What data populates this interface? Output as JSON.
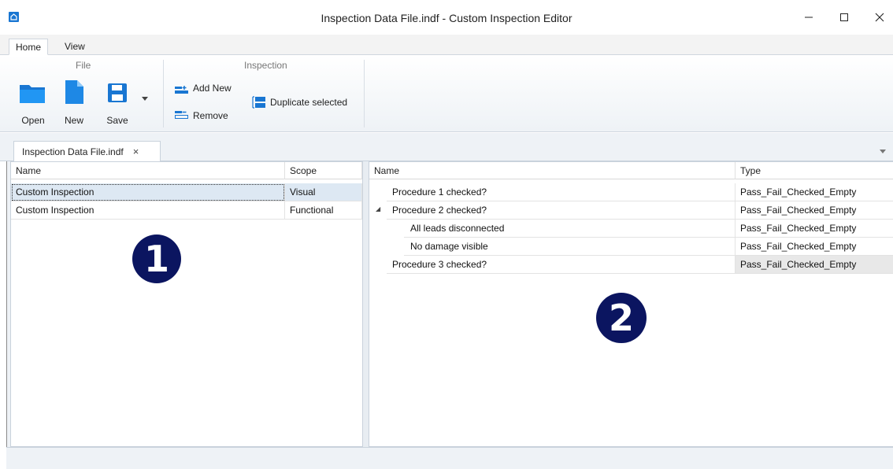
{
  "window": {
    "title": "Inspection Data File.indf - Custom Inspection Editor",
    "icon": "app-icon",
    "controls": [
      "minimize-icon",
      "maximize-icon",
      "close-icon"
    ]
  },
  "ribbon": {
    "tabs": [
      {
        "label": "Home",
        "active": true
      },
      {
        "label": "View",
        "active": false
      }
    ],
    "groups": {
      "file": {
        "title": "File",
        "buttons": [
          {
            "label": "Open",
            "icon": "folder-icon"
          },
          {
            "label": "New",
            "icon": "new-document-icon"
          },
          {
            "label": "Save",
            "icon": "save-icon"
          }
        ]
      },
      "inspection": {
        "title": "Inspection",
        "buttons": [
          {
            "label": "Add New",
            "icon": "add-row-icon"
          },
          {
            "label": "Remove",
            "icon": "remove-row-icon"
          },
          {
            "label": "Duplicate selected",
            "icon": "duplicate-icon"
          }
        ]
      }
    }
  },
  "document_tab": {
    "label": "Inspection Data File.indf",
    "close": "×"
  },
  "left_grid": {
    "columns": [
      "Name",
      "Scope"
    ],
    "rows": [
      {
        "name": "Custom Inspection",
        "scope": "Visual",
        "selected": true
      },
      {
        "name": "Custom Inspection",
        "scope": "Functional",
        "selected": false
      }
    ],
    "badge": "1"
  },
  "right_grid": {
    "columns": [
      "Name",
      "Type"
    ],
    "rows": [
      {
        "name": "Procedure 1 checked?",
        "type": "Pass_Fail_Checked_Empty",
        "level": 0,
        "expander": ""
      },
      {
        "name": "Procedure 2 checked?",
        "type": "Pass_Fail_Checked_Empty",
        "level": 0,
        "expander": "◢"
      },
      {
        "name": "All leads disconnected",
        "type": "Pass_Fail_Checked_Empty",
        "level": 1,
        "expander": ""
      },
      {
        "name": "No damage visible",
        "type": "Pass_Fail_Checked_Empty",
        "level": 1,
        "expander": ""
      },
      {
        "name": "Procedure 3 checked?",
        "type": "Pass_Fail_Checked_Empty",
        "level": 0,
        "expander": ""
      }
    ],
    "badge": "2"
  },
  "colors": {
    "accent": "#1976d2",
    "badge": "#0b1560",
    "selection": "#dde8f3"
  }
}
